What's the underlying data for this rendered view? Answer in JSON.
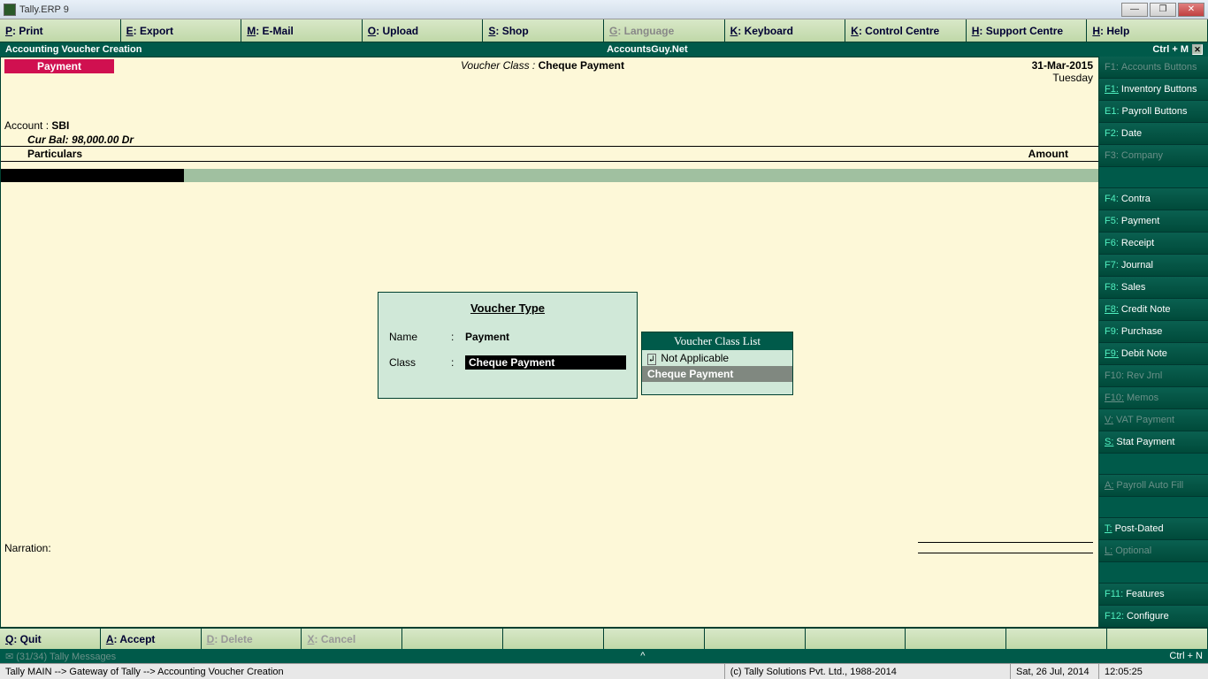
{
  "window": {
    "title": "Tally.ERP 9"
  },
  "topmenu": [
    {
      "key": "P",
      "label": ": Print",
      "disabled": false
    },
    {
      "key": "E",
      "label": ": Export",
      "disabled": false
    },
    {
      "key": "M",
      "label": ": E-Mail",
      "disabled": false
    },
    {
      "key": "O",
      "label": ": Upload",
      "disabled": false
    },
    {
      "key": "S",
      "label": ": Shop",
      "disabled": false
    },
    {
      "key": "G",
      "label": ": Language",
      "disabled": true
    },
    {
      "key": "K",
      "label": ": Keyboard",
      "disabled": false
    },
    {
      "key": "K",
      "label": ": Control Centre",
      "disabled": false
    },
    {
      "key": "H",
      "label": ": Support Centre",
      "disabled": false
    },
    {
      "key": "H",
      "label": ": Help",
      "disabled": false
    }
  ],
  "header": {
    "left": "Accounting Voucher  Creation",
    "center": "AccountsGuy.Net",
    "right": "Ctrl + M"
  },
  "voucher": {
    "badge": "Payment",
    "class_label": "Voucher Class :",
    "class_value": "Cheque Payment",
    "date": "31-Mar-2015",
    "day": "Tuesday",
    "account_label": "Account :",
    "account_value": "SBI",
    "curbal_label": "Cur Bal:",
    "curbal_value": "98,000.00 Dr",
    "col_particulars": "Particulars",
    "col_amount": "Amount",
    "narration_label": "Narration:"
  },
  "vtype_dialog": {
    "title": "Voucher Type",
    "name_label": "Name",
    "name_value": "Payment",
    "class_label": "Class",
    "class_value": "Cheque Payment"
  },
  "vclass_list": {
    "title": "Voucher Class List",
    "items": [
      {
        "label": "Not Applicable",
        "selected": false,
        "ret": true
      },
      {
        "label": "Cheque Payment",
        "selected": true,
        "ret": false
      }
    ]
  },
  "sidebar": [
    {
      "key": "F1",
      "label": "Accounts Buttons",
      "disabled": true,
      "ul": false
    },
    {
      "key": "F1",
      "label": "Inventory Buttons",
      "disabled": false,
      "ul": true
    },
    {
      "key": "E1",
      "label": "Payroll Buttons",
      "disabled": false,
      "ul": false
    },
    {
      "key": "F2",
      "label": "Date",
      "disabled": false,
      "ul": false
    },
    {
      "key": "F3",
      "label": "Company",
      "disabled": true,
      "ul": false
    },
    {
      "gap": true
    },
    {
      "key": "F4",
      "label": "Contra",
      "disabled": false,
      "ul": false
    },
    {
      "key": "F5",
      "label": "Payment",
      "disabled": false,
      "ul": false
    },
    {
      "key": "F6",
      "label": "Receipt",
      "disabled": false,
      "ul": false
    },
    {
      "key": "F7",
      "label": "Journal",
      "disabled": false,
      "ul": false
    },
    {
      "key": "F8",
      "label": "Sales",
      "disabled": false,
      "ul": false
    },
    {
      "key": "F8",
      "label": "Credit Note",
      "disabled": false,
      "ul": true
    },
    {
      "key": "F9",
      "label": "Purchase",
      "disabled": false,
      "ul": false
    },
    {
      "key": "F9",
      "label": "Debit Note",
      "disabled": false,
      "ul": true
    },
    {
      "key": "F10",
      "label": "Rev Jrnl",
      "disabled": true,
      "ul": false
    },
    {
      "key": "F10",
      "label": "Memos",
      "disabled": true,
      "ul": true
    },
    {
      "key": "V",
      "label": "VAT Payment",
      "disabled": true,
      "ul": true
    },
    {
      "key": "S",
      "label": "Stat Payment",
      "disabled": false,
      "ul": true
    },
    {
      "gap": true
    },
    {
      "key": "A",
      "label": "Payroll Auto Fill",
      "disabled": true,
      "ul": true
    },
    {
      "gap": true
    },
    {
      "key": "T",
      "label": "Post-Dated",
      "disabled": false,
      "ul": true
    },
    {
      "key": "L",
      "label": "Optional",
      "disabled": true,
      "ul": true
    },
    {
      "gap": true
    },
    {
      "key": "F11",
      "label": "Features",
      "disabled": false,
      "ul": false
    },
    {
      "key": "F12",
      "label": "Configure",
      "disabled": false,
      "ul": false
    }
  ],
  "botmenu": [
    {
      "key": "Q",
      "label": ": Quit",
      "disabled": false
    },
    {
      "key": "A",
      "label": ": Accept",
      "disabled": false
    },
    {
      "key": "D",
      "label": ": Delete",
      "disabled": true
    },
    {
      "key": "X",
      "label": ": Cancel",
      "disabled": true
    },
    {
      "key": "",
      "label": "",
      "disabled": true
    },
    {
      "key": "",
      "label": "",
      "disabled": true
    },
    {
      "key": "",
      "label": "",
      "disabled": true
    },
    {
      "key": "",
      "label": "",
      "disabled": true
    },
    {
      "key": "",
      "label": "",
      "disabled": true
    },
    {
      "key": "",
      "label": "",
      "disabled": true
    },
    {
      "key": "",
      "label": "",
      "disabled": true
    },
    {
      "key": "",
      "label": "",
      "disabled": true
    }
  ],
  "msgbar": {
    "left": "✉ (31/34) Tally Messages",
    "center": "^",
    "right": "Ctrl + N"
  },
  "statusbar": {
    "path": "Tally MAIN --> Gateway of Tally --> Accounting Voucher  Creation",
    "copyright": "(c) Tally Solutions Pvt. Ltd., 1988-2014",
    "date": "Sat, 26 Jul, 2014",
    "time": "12:05:25"
  }
}
